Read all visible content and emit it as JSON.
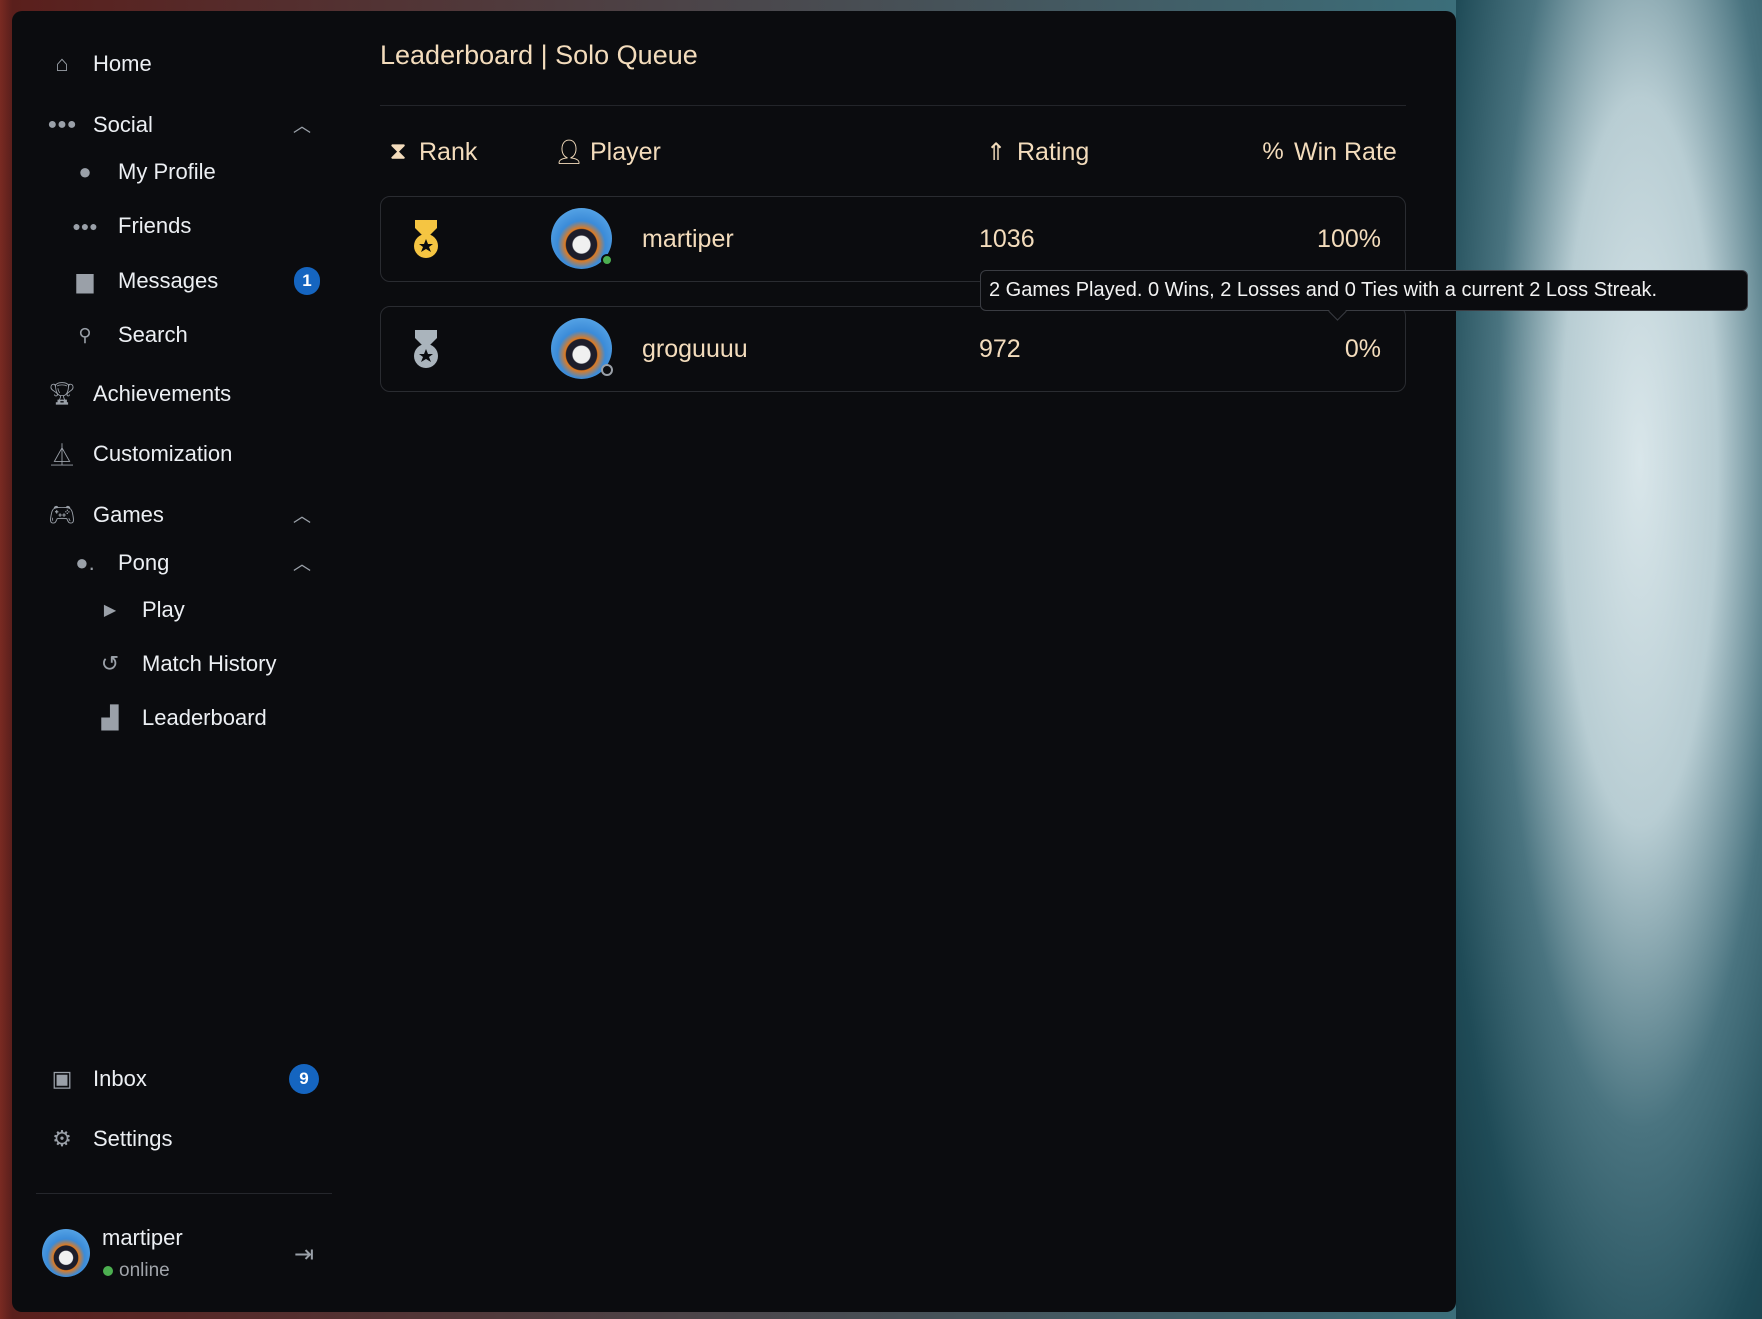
{
  "sidebar": {
    "items": [
      {
        "label": "Home",
        "icon": "home-icon"
      },
      {
        "label": "Social",
        "icon": "group-icon"
      },
      {
        "label": "My Profile",
        "icon": "person-icon"
      },
      {
        "label": "Friends",
        "icon": "group-icon"
      },
      {
        "label": "Messages",
        "icon": "forum-icon",
        "badge": "1"
      },
      {
        "label": "Search",
        "icon": "person-search-icon"
      },
      {
        "label": "Achievements",
        "icon": "trophy-icon"
      },
      {
        "label": "Customization",
        "icon": "hanger-icon"
      },
      {
        "label": "Games",
        "icon": "gamepad-icon"
      },
      {
        "label": "Pong",
        "icon": "ping-pong-icon"
      },
      {
        "label": "Play",
        "icon": "play-icon"
      },
      {
        "label": "Match History",
        "icon": "history-icon"
      },
      {
        "label": "Leaderboard",
        "icon": "leaderboard-icon"
      },
      {
        "label": "Inbox",
        "icon": "inbox-icon",
        "badge": "9"
      },
      {
        "label": "Settings",
        "icon": "gear-icon"
      }
    ],
    "user": {
      "name": "martiper",
      "status": "online",
      "status_color": "#4caf50"
    }
  },
  "main": {
    "title": "Leaderboard | Solo Queue",
    "columns": [
      "Rank",
      "Player",
      "Rating",
      "Win Rate"
    ],
    "rows": [
      {
        "rank": 1,
        "medal_color": "#f5c542",
        "player": "martiper",
        "online": true,
        "rating": "1036",
        "win_rate": "100%"
      },
      {
        "rank": 2,
        "medal_color": "#aab4bc",
        "player": "groguuuu",
        "online": false,
        "rating": "972",
        "win_rate": "0%"
      }
    ],
    "tooltip": "2 Games Played. 0 Wins, 2 Losses and 0 Ties with a current 2 Loss Streak."
  },
  "colors": {
    "accent_text": "#f3dcbc",
    "badge": "#1565c0",
    "panel": "#0b0c0f"
  }
}
